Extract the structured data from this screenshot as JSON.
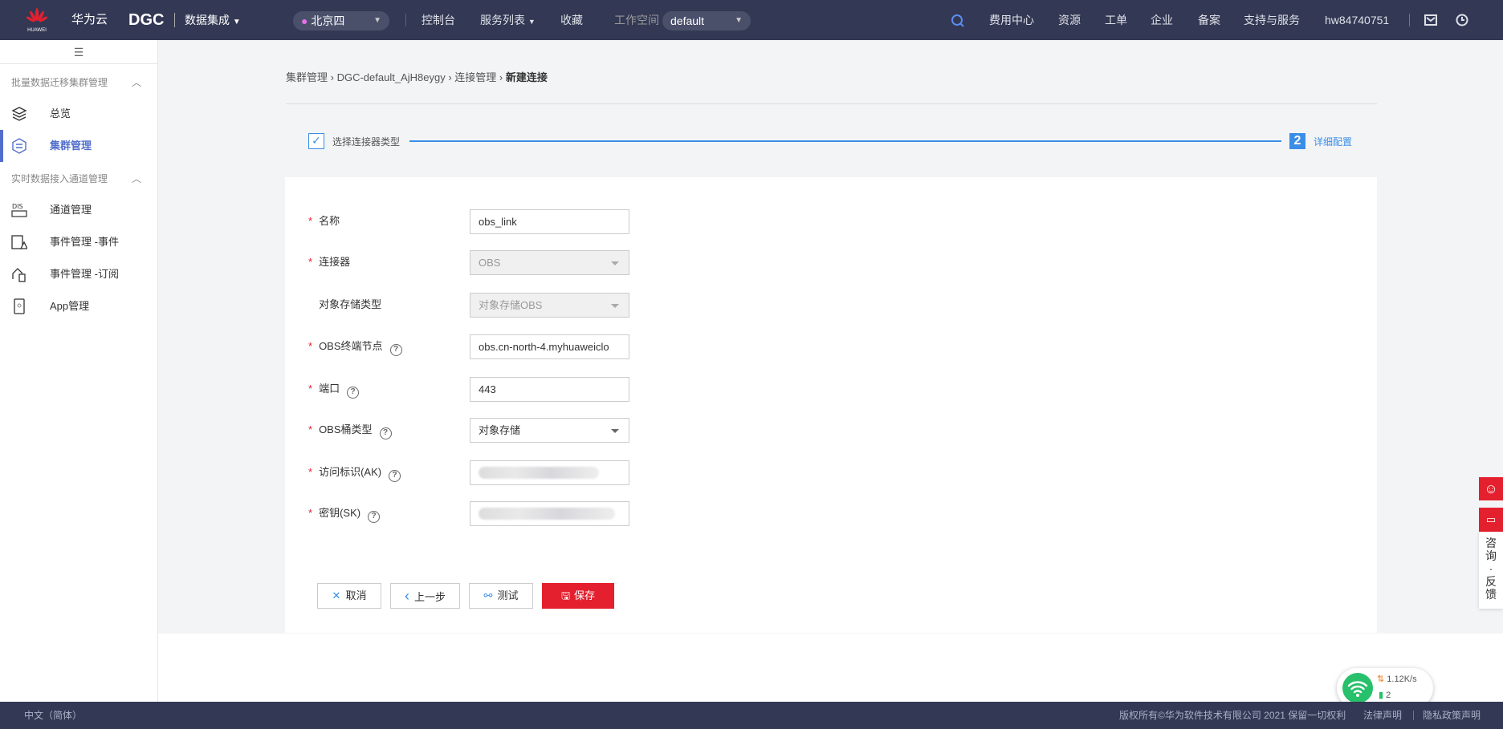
{
  "header": {
    "brand": "华为云",
    "logo_text": "HUAWEI",
    "product": "DGC",
    "module": "数据集成",
    "region": "北京四",
    "nav": [
      "控制台",
      "服务列表",
      "收藏"
    ],
    "workspace_label": "工作空间",
    "workspace": "default",
    "right_nav": [
      "费用中心",
      "资源",
      "工单",
      "企业",
      "备案",
      "支持与服务"
    ],
    "user": "hw84740751",
    "icons": [
      "search-icon",
      "mail-icon",
      "clock-icon"
    ]
  },
  "sidebar": {
    "groups": [
      {
        "title": "批量数据迁移集群管理",
        "items": [
          {
            "label": "总览",
            "icon": "layers-icon"
          },
          {
            "label": "集群管理",
            "icon": "cluster-icon",
            "active": true
          }
        ]
      },
      {
        "title": "实时数据接入通道管理",
        "items": [
          {
            "label": "通道管理",
            "icon": "dis-icon"
          },
          {
            "label": "事件管理 -事件",
            "icon": "event-icon"
          },
          {
            "label": "事件管理 -订阅",
            "icon": "subscribe-icon"
          },
          {
            "label": "App管理",
            "icon": "app-icon"
          }
        ]
      }
    ]
  },
  "breadcrumb": [
    "集群管理",
    "DGC-default_AjH8eygy",
    "连接管理",
    "新建连接"
  ],
  "steps": {
    "step1": "选择连接器类型",
    "step2_num": "2",
    "step2": "详细配置"
  },
  "form": {
    "fields": [
      {
        "label": "名称",
        "required": true,
        "value": "obs_link"
      },
      {
        "label": "连接器",
        "required": true,
        "value": "OBS",
        "type": "select",
        "disabled": true
      },
      {
        "label": "对象存储类型",
        "required": false,
        "value": "对象存储OBS",
        "type": "select",
        "disabled": true
      },
      {
        "label": "OBS终端节点",
        "required": true,
        "help": true,
        "value": "obs.cn-north-4.myhuaweiclo"
      },
      {
        "label": "端口",
        "required": true,
        "help": true,
        "value": "443"
      },
      {
        "label": "OBS桶类型",
        "required": true,
        "help": true,
        "value": "对象存储",
        "type": "select"
      },
      {
        "label": "访问标识(AK)",
        "required": true,
        "help": true,
        "value": ""
      },
      {
        "label": "密钥(SK)",
        "required": true,
        "help": true,
        "value": ""
      }
    ],
    "buttons": {
      "cancel": "取消",
      "prev": "上一步",
      "test": "测试",
      "save": "保存"
    }
  },
  "feedback": {
    "text": [
      "咨",
      "询",
      "·",
      "反",
      "馈"
    ]
  },
  "network": {
    "speed": "1.12K/s",
    "count": "2"
  },
  "footer": {
    "lang": "中文（简体）",
    "copyright": "版权所有©华为软件技术有限公司 2021 保留一切权利",
    "legal": "法律声明",
    "privacy": "隐私政策声明"
  },
  "colors": {
    "header_bg": "#333854",
    "accent": "#526ecc",
    "primary_red": "#e4202e",
    "step_blue": "#3a8ee6"
  }
}
